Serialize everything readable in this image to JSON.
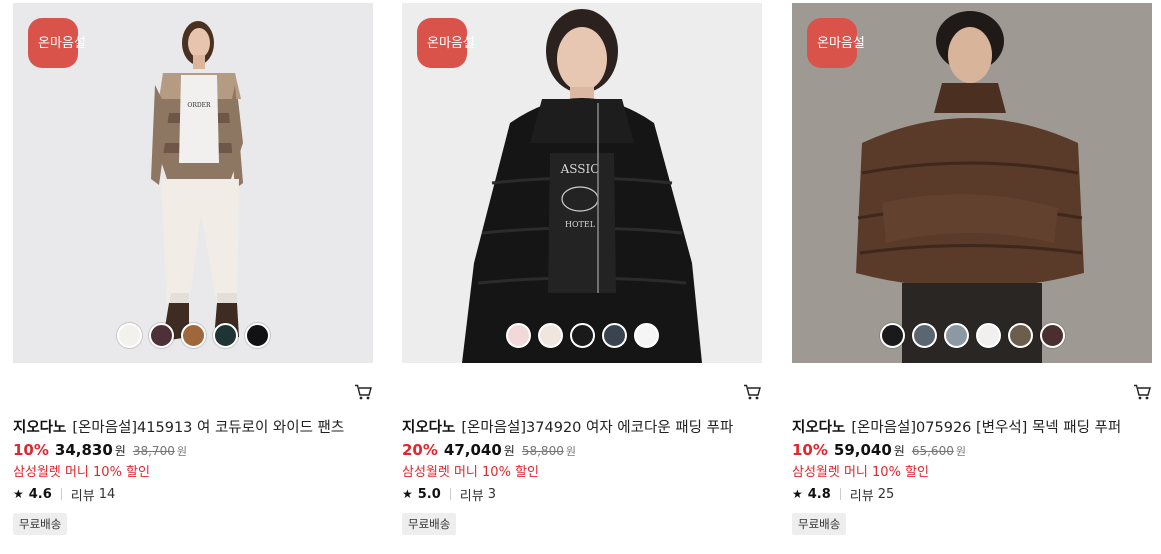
{
  "products": [
    {
      "badge": "온마음설",
      "brand": "지오다노",
      "name": "[온마음설]415913 여 코듀로이 와이드 팬츠",
      "discount_rate": "10%",
      "sale_price": "34,830",
      "currency": "원",
      "original_price": "38,700",
      "promo": "삼성월렛 머니 10% 할인",
      "rating": "4.6",
      "review_label": "리뷰",
      "review_count": "14",
      "tag": "무료배송",
      "swatches": [
        "#f3f1ee",
        "#4e3038",
        "#a0683a",
        "#1f3434",
        "#121212"
      ]
    },
    {
      "badge": "온마음설",
      "brand": "지오다노",
      "name": "[온마음설]374920 여자 에코다운 패딩 푸파",
      "discount_rate": "20%",
      "sale_price": "47,040",
      "currency": "원",
      "original_price": "58,800",
      "promo": "삼성월렛 머니 10% 할인",
      "rating": "5.0",
      "review_label": "리뷰",
      "review_count": "3",
      "tag": "무료배송",
      "swatches": [
        "#f2d9d9",
        "#efe7df",
        "#1a1a1a",
        "#3a4450",
        "#f5f5f5"
      ]
    },
    {
      "badge": "온마음설",
      "brand": "지오다노",
      "name": "[온마음설]075926 [변우석] 목넥 패딩 푸퍼",
      "discount_rate": "10%",
      "sale_price": "59,040",
      "currency": "원",
      "original_price": "65,600",
      "promo": "삼성월렛 머니 10% 할인",
      "rating": "4.8",
      "review_label": "리뷰",
      "review_count": "25",
      "tag": "무료배송",
      "swatches": [
        "#1a1a1a",
        "#5b6670",
        "#8c99a3",
        "#f2f0ee",
        "#6b5e4c",
        "#4a2e30"
      ]
    }
  ],
  "icons": {
    "cart": "cart-icon",
    "star": "star-icon"
  },
  "colors": {
    "badge": "#d9534b",
    "discount": "#e3262d",
    "promo": "#e3262d",
    "tag_bg": "#eeeeee"
  }
}
